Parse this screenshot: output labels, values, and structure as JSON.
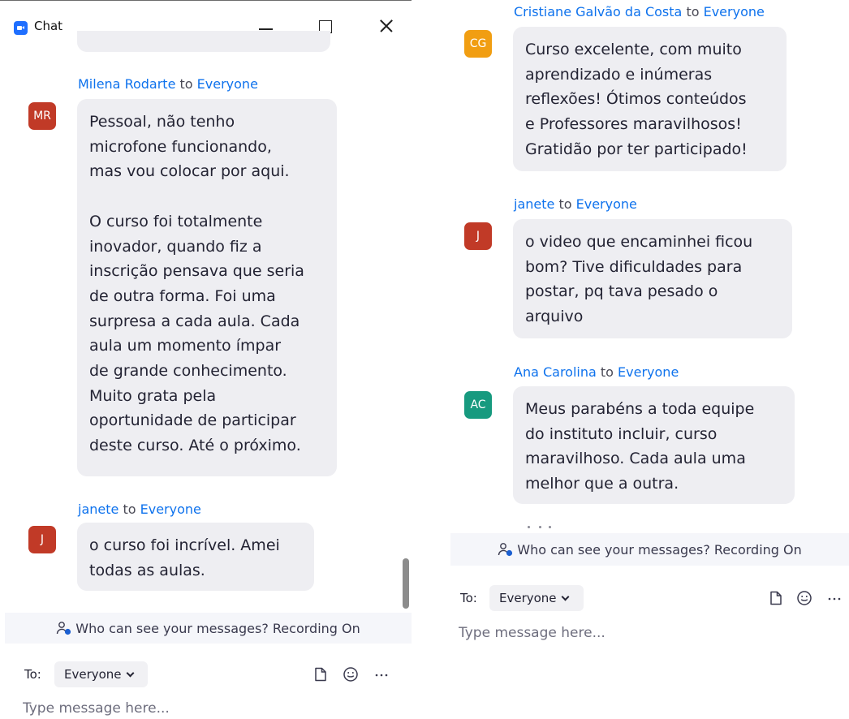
{
  "window": {
    "title": "Chat"
  },
  "left": {
    "messages": [
      {
        "sender": "Milena Rodarte",
        "to_word": "to",
        "recipient": "Everyone",
        "initials": "MR",
        "avatar_color": "#c13a27",
        "text": "Pessoal, não tenho\nmicrofone funcionando,\nmas vou colocar por aqui.\n\nO curso foi totalmente\ninovador, quando fiz a\ninscrição pensava que seria\nde outra forma. Foi uma\nsurpresa a cada aula. Cada\naula um momento ímpar\nde grande conhecimento.\nMuito grata pela\noportunidade de participar\ndeste curso. Até o próximo."
      },
      {
        "sender": "janete",
        "to_word": "to",
        "recipient": "Everyone",
        "initials": "J",
        "avatar_color": "#c13a27",
        "text": "o curso foi incrível. Amei\ntodas as aulas."
      }
    ],
    "footer": {
      "notice": "Who can see your messages? Recording On",
      "to_label": "To:",
      "recipient": "Everyone",
      "input_placeholder": "Type message here..."
    }
  },
  "right": {
    "messages": [
      {
        "sender": "Cristiane Galvão da Costa",
        "to_word": "to",
        "recipient": "Everyone",
        "initials": "CG",
        "avatar_color": "#f19e12",
        "text": "Curso excelente, com muito\naprendizado e inúmeras\nreflexões! Ótimos conteúdos\ne Professores maravilhosos!\nGratidão por ter participado!"
      },
      {
        "sender": "janete",
        "to_word": "to",
        "recipient": "Everyone",
        "initials": "J",
        "avatar_color": "#c13a27",
        "text": "o video que encaminhei ficou\nbom? Tive dificuldades para\npostar, pq tava pesado o\narquivo"
      },
      {
        "sender": "Ana Carolina ",
        "to_word": "to",
        "recipient": "Everyone",
        "initials": "AC",
        "avatar_color": "#179a7f",
        "text": "Meus parabéns a toda equipe\ndo instituto incluir, curso\nmaravilhoso. Cada aula uma\nmelhor que a outra."
      }
    ],
    "footer": {
      "notice": "Who can see your messages? Recording On",
      "to_label": "To:",
      "recipient": "Everyone",
      "input_placeholder": "Type message here..."
    }
  },
  "icons": {
    "app": "zoom-chat-icon",
    "minimize": "minimize-icon",
    "maximize": "maximize-icon",
    "close": "close-icon",
    "notice": "users-icon",
    "dropdown": "chevron-down-icon",
    "file": "file-icon",
    "emoji": "emoji-icon",
    "more": "more-icon"
  },
  "colors": {
    "link": "#0e72ed",
    "bubble": "#eeeef2",
    "notice_bg": "#f5f6fa"
  }
}
